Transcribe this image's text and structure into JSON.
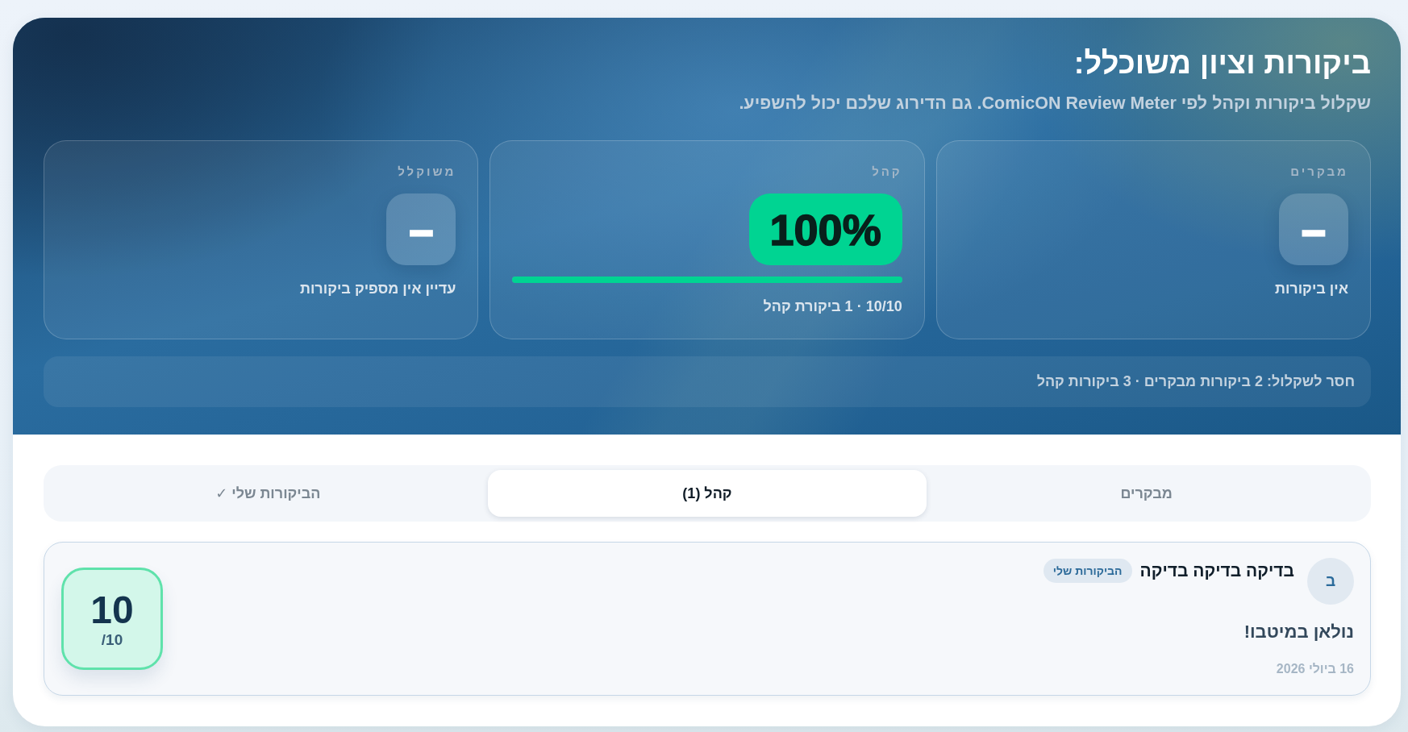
{
  "header": {
    "title": "ביקורות וציון משוכלל:",
    "subtitle": "שקלול ביקורות וקהל לפי ComicON Review Meter. גם הדירוג שלכם יכול להשפיע."
  },
  "score_cards": [
    {
      "kind": "empty",
      "label": "מבקרים",
      "value": "–",
      "caption": "אין ביקורות"
    },
    {
      "kind": "meter",
      "label": "קהל",
      "value": "100%",
      "level": 1,
      "caption": "10/10 · 1 ביקורת קהל"
    },
    {
      "kind": "empty",
      "label": "משוקלל",
      "value": "–",
      "caption": "עדיין אין מספיק ביקורות"
    }
  ],
  "missing_note": "חסר לשקלול: 2 ביקורות מבקרים · 3 ביקורות קהל",
  "tabs": [
    {
      "label": "מבקרים",
      "selected": false
    },
    {
      "label": "קהל (1)",
      "selected": true
    },
    {
      "label": "הביקורות שלי ✓",
      "selected": false
    }
  ],
  "reviews": [
    {
      "avatar_letter": "ב",
      "author": "בדיקה בדיקה בדיקה",
      "tag": "הביקורות שלי",
      "text": "נולאן במיטבו!",
      "date": "16 ביולי 2026",
      "rating": "10",
      "rating_scale": "/10"
    }
  ]
}
